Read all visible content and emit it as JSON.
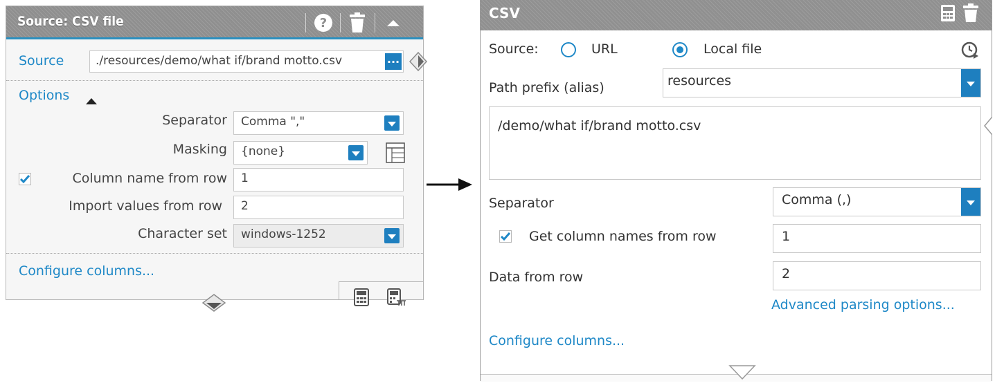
{
  "left_panel": {
    "title": "Source: CSV file",
    "source_label": "Source",
    "source_value": "./resources/demo/what if/brand motto.csv",
    "browse_label": "...",
    "options_label": "Options",
    "separator_label": "Separator",
    "separator_value": "Comma \",\"",
    "masking_label": "Masking",
    "masking_value": "{none}",
    "column_name_label": "Column name from row",
    "column_name_checked": true,
    "column_name_value": "1",
    "import_values_label": "Import values from row",
    "import_values_value": "2",
    "charset_label": "Character set",
    "charset_value": "windows-1252",
    "configure_columns": "Configure columns..."
  },
  "right_panel": {
    "title": "CSV",
    "source_label": "Source:",
    "radio_url_label": "URL",
    "radio_local_label": "Local file",
    "selected_source": "Local file",
    "path_prefix_label": "Path prefix (alias)",
    "path_prefix_value": "resources",
    "path_value": "/demo/what if/brand motto.csv",
    "separator_label": "Separator",
    "separator_value": "Comma (,)",
    "column_names_label": "Get column names from row",
    "column_names_checked": true,
    "column_names_value": "1",
    "data_from_row_label": "Data from row",
    "data_from_row_value": "2",
    "advanced_parsing": "Advanced parsing options...",
    "configure_columns": "Configure columns..."
  },
  "colors": {
    "accent": "#1e88c7",
    "header_bg": "#8f8f8f",
    "dropdown_button": "#1e7fbf"
  },
  "icons": [
    "help-icon",
    "trash-icon",
    "collapse-icon",
    "options-expanded-icon",
    "masking-table-icon",
    "calculator-icon",
    "calculator-grid-icon",
    "connector-diamond-icon",
    "arrow-right-icon",
    "history-icon",
    "connector-triangle-icon"
  ]
}
